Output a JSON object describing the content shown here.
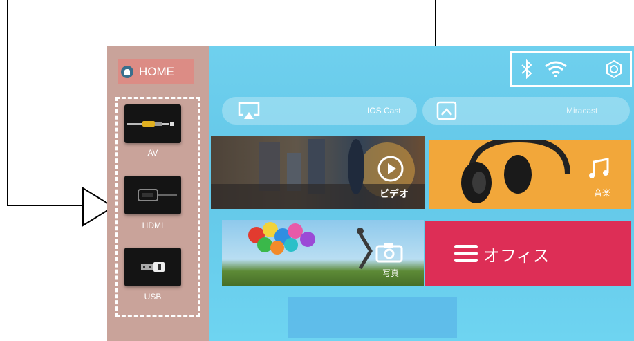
{
  "sidebar": {
    "home_label": "HOME",
    "sources": [
      {
        "label": "AV",
        "icon": "av-cable-icon"
      },
      {
        "label": "HDMI",
        "icon": "hdmi-cable-icon"
      },
      {
        "label": "USB",
        "icon": "usb-drive-icon"
      }
    ]
  },
  "cast_bar": {
    "ios_label": "IOS Cast",
    "miracast_label": "Miracast"
  },
  "tiles": {
    "video_label": "ビデオ",
    "music_label": "音楽",
    "photo_label": "写真",
    "office_label": "オフィス"
  },
  "status_icons": [
    "bluetooth-icon",
    "wifi-icon",
    "settings-icon"
  ],
  "colors": {
    "main_bg": "#6fd0ee",
    "sidebar_bg": "#c9a39a",
    "home_highlight": "#dc8c85",
    "music_tile": "#f2a73a",
    "office_tile": "#dd2e56"
  }
}
